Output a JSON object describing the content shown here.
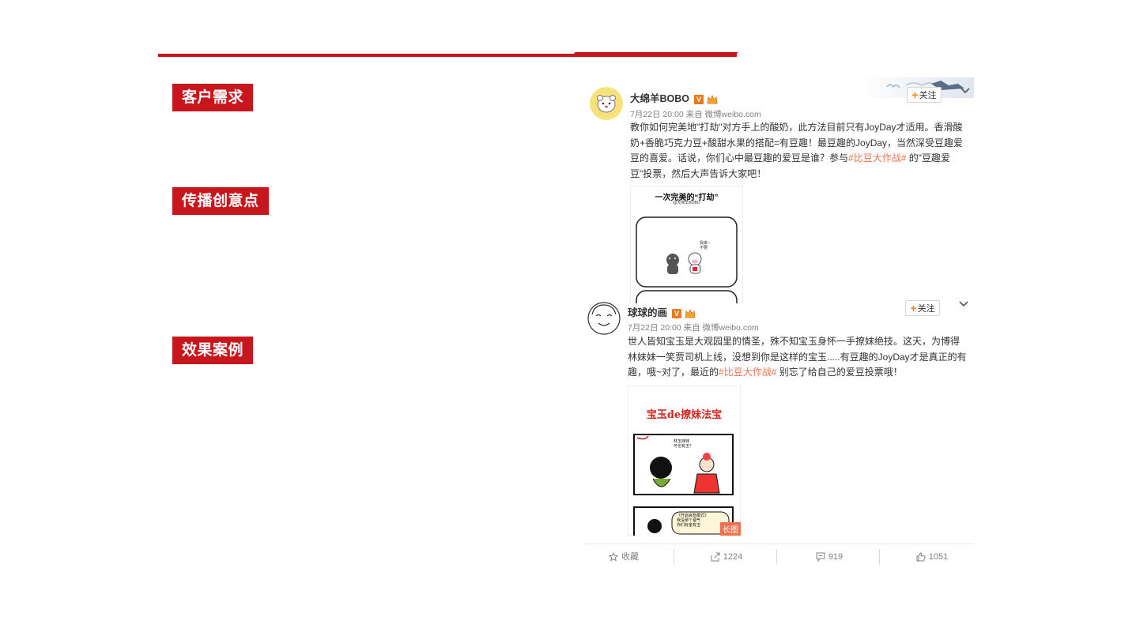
{
  "sections": {
    "requirement": "客户需求",
    "creative": "传播创意点",
    "cases": "效果案例"
  },
  "post1": {
    "username": "大绵羊BOBO",
    "verified_badge": "V",
    "meta": "7月22日 20:00 来自 微博weibo.com",
    "follow_label": "关注",
    "content_pre": "教你如何完美地\"打劫\"对方手上的酸奶，此方法目前只有JoyDay才适用。香滑酸奶+香脆巧克力豆+酸甜水果的搭配=有豆趣！最豆趣的JoyDay，当然深受豆趣爱豆的喜爱。话说，你们心中最豆趣的爱豆是谁？参与",
    "hashtag": "#比豆大作战#",
    "content_post": " 的\"豆趣爱豆\"投票，然后大声告诉大家吧！",
    "comic_title": "一次完美的“打劫”",
    "comic_sub": "@大绵羊BOBO",
    "comic_speech": "我来~\n不要"
  },
  "post2": {
    "username": "球球的画",
    "verified_badge": "V",
    "meta": "7月22日 20:00 来自 微博weibo.com",
    "follow_label": "关注",
    "content_pre": "世人皆知宝玉是大观园里的情圣，殊不知宝玉身怀一手撩妹绝技。这天，为博得林妹妹一笑贾司机上线，没想到你是这样的宝玉.....有豆趣的JoyDay才是真正的有趣，哦~对了，最近的",
    "hashtag": "#比豆大作战#",
    "content_post": " 别忘了给自己的爱豆投票哦！",
    "comic_title": "宝玉de撩妹法宝",
    "comic_speech1": "林玉妹妹\n可也有玉？",
    "comic_speech2": "《开启哀愁模式》\n我没那个福气\n你们有金有玉",
    "long_image_label": "长图"
  },
  "actions": {
    "favorite": "收藏",
    "repost": "1224",
    "comment": "919",
    "like": "1051"
  },
  "colors": {
    "brand_red": "#c8161d",
    "weibo_orange": "#ff8200",
    "hashtag": "#eb7350"
  }
}
